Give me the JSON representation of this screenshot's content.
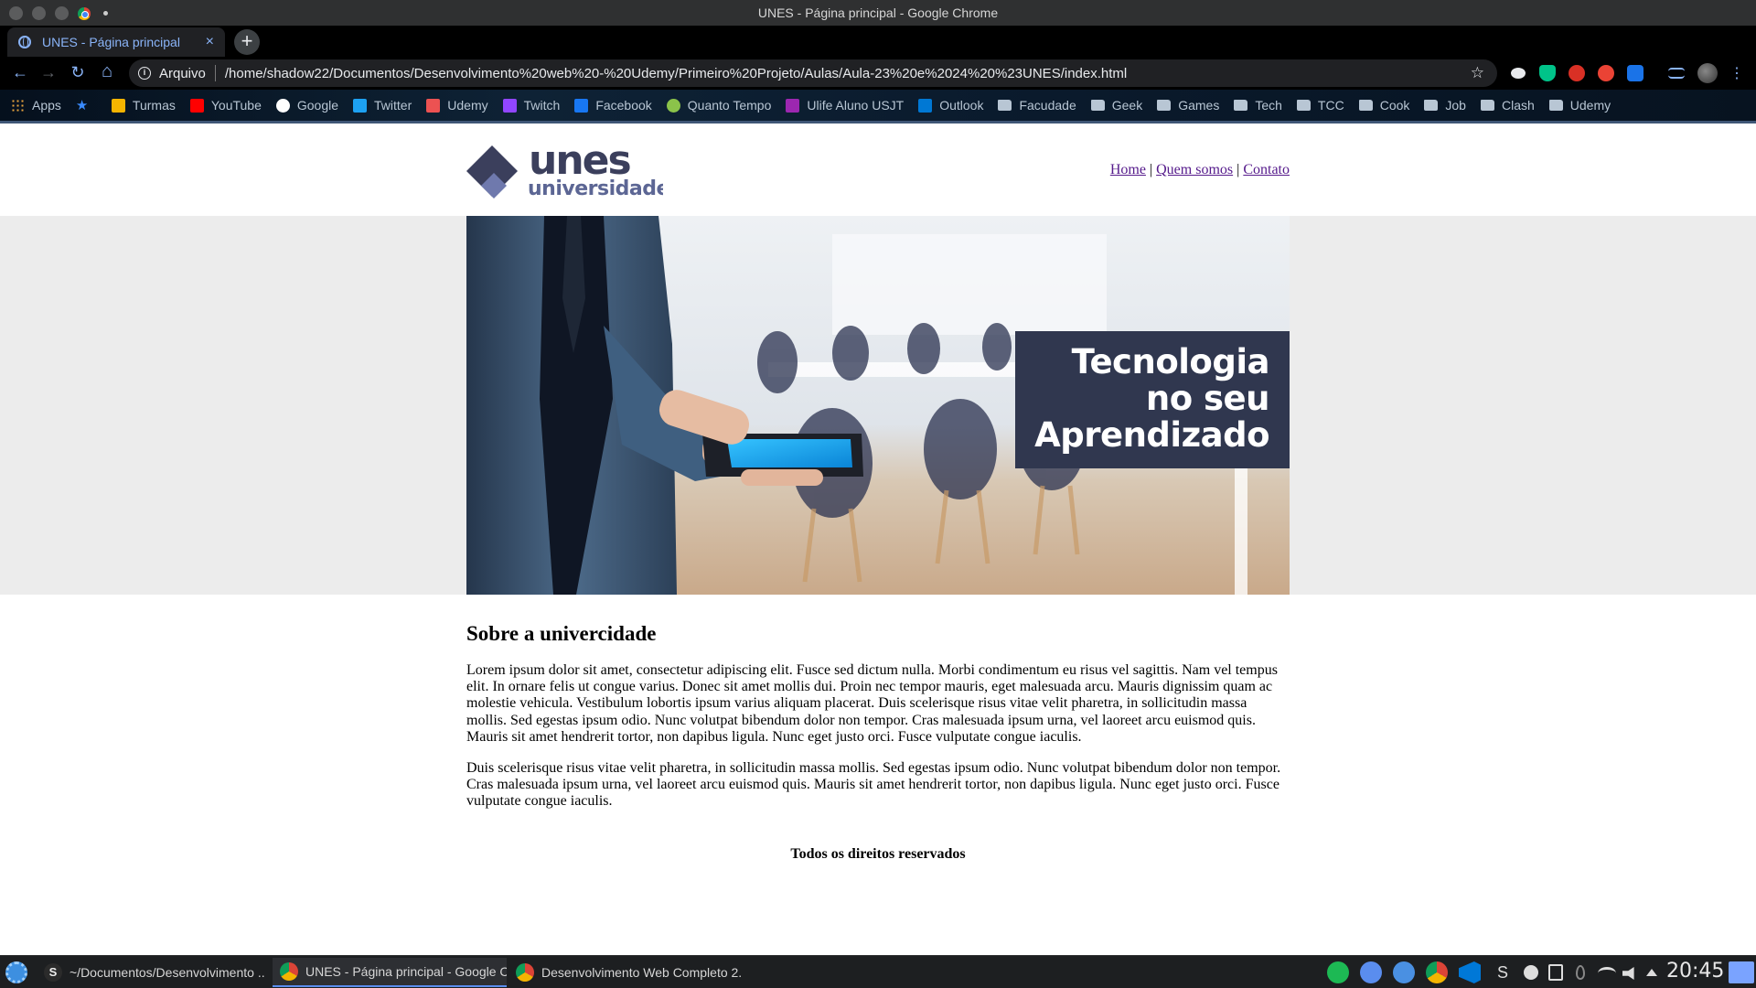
{
  "window": {
    "title": "UNES - Página principal - Google Chrome"
  },
  "tabs": [
    {
      "label": "UNES - Página principal",
      "close": "×"
    }
  ],
  "new_tab_label": "+",
  "toolbar": {
    "back": "←",
    "forward": "→",
    "reload": "↻",
    "home": "⌂",
    "scheme_label": "Arquivo",
    "url": "/home/shadow22/Documentos/Desenvolvimento%20web%20-%20Udemy/Primeiro%20Projeto/Aulas/Aula-23%20e%2024%20%23UNES/index.html",
    "bookmark_star": "☆"
  },
  "bookmarks": [
    {
      "label": "Apps",
      "icon": "apps-grid-icon",
      "color": "#e8a33d"
    },
    {
      "label": "",
      "icon": "star-icon",
      "color": "#3a8bfd"
    },
    {
      "label": "Turmas",
      "icon": "classroom-icon",
      "color": "#f5b400"
    },
    {
      "label": "YouTube",
      "icon": "youtube-icon",
      "color": "#ff0000"
    },
    {
      "label": "Google",
      "icon": "google-icon",
      "color": "#ffffff"
    },
    {
      "label": "Twitter",
      "icon": "twitter-icon",
      "color": "#1da1f2"
    },
    {
      "label": "Udemy",
      "icon": "udemy-icon",
      "color": "#ec5252"
    },
    {
      "label": "Twitch",
      "icon": "twitch-icon",
      "color": "#9146ff"
    },
    {
      "label": "Facebook",
      "icon": "facebook-icon",
      "color": "#1877f2"
    },
    {
      "label": "Quanto Tempo",
      "icon": "clock-icon",
      "color": "#8bc34a"
    },
    {
      "label": "Ulife Aluno USJT",
      "icon": "ulife-icon",
      "color": "#9c27b0"
    },
    {
      "label": "Outlook",
      "icon": "outlook-icon",
      "color": "#0078d4"
    },
    {
      "label": "Facudade",
      "icon": "folder-icon"
    },
    {
      "label": "Geek",
      "icon": "folder-icon"
    },
    {
      "label": "Games",
      "icon": "folder-icon"
    },
    {
      "label": "Tech",
      "icon": "folder-icon"
    },
    {
      "label": "TCC",
      "icon": "folder-icon"
    },
    {
      "label": "Cook",
      "icon": "folder-icon"
    },
    {
      "label": "Job",
      "icon": "folder-icon"
    },
    {
      "label": "Clash",
      "icon": "folder-icon"
    },
    {
      "label": "Udemy",
      "icon": "folder-icon"
    }
  ],
  "site": {
    "logo": {
      "line1": "unes",
      "line2": "universidade",
      "color": "#3b3f5c",
      "accent": "#5c6694"
    },
    "nav": {
      "home": "Home",
      "sep1": "|",
      "about": "Quem somos",
      "sep2": "|",
      "contact": "Contato"
    },
    "banner": {
      "line1": "Tecnologia",
      "line2": "no seu",
      "line3": "Aprendizado",
      "box_color": "#30374f"
    },
    "section_title": "Sobre a univercidade",
    "paragraph1": "Lorem ipsum dolor sit amet, consectetur adipiscing elit. Fusce sed dictum nulla. Morbi condimentum eu risus vel sagittis. Nam vel tempus elit. In ornare felis ut congue varius. Donec sit amet mollis dui. Proin nec tempor mauris, eget malesuada arcu. Mauris dignissim quam ac molestie vehicula. Vestibulum lobortis ipsum varius aliquam placerat. Duis scelerisque risus vitae velit pharetra, in sollicitudin massa mollis. Sed egestas ipsum odio. Nunc volutpat bibendum dolor non tempor. Cras malesuada ipsum urna, vel laoreet arcu euismod quis. Mauris sit amet hendrerit tortor, non dapibus ligula. Nunc eget justo orci. Fusce vulputate congue iaculis.",
    "paragraph2": "Duis scelerisque risus vitae velit pharetra, in sollicitudin massa mollis. Sed egestas ipsum odio. Nunc volutpat bibendum dolor non tempor. Cras malesuada ipsum urna, vel laoreet arcu euismod quis. Mauris sit amet hendrerit tortor, non dapibus ligula. Nunc eget justo orci. Fusce vulputate congue iaculis.",
    "footer": "Todos os direitos reservados"
  },
  "taskbar": {
    "items": [
      {
        "label": "~/Documentos/Desenvolvimento ...",
        "icon": "terminal-icon"
      },
      {
        "label": "UNES - Página principal - Google C...",
        "icon": "chrome-icon"
      },
      {
        "label": "Desenvolvimento Web Completo 2...",
        "icon": "chrome-icon"
      }
    ],
    "terminal_glyph": "S",
    "clock": "20:45"
  }
}
